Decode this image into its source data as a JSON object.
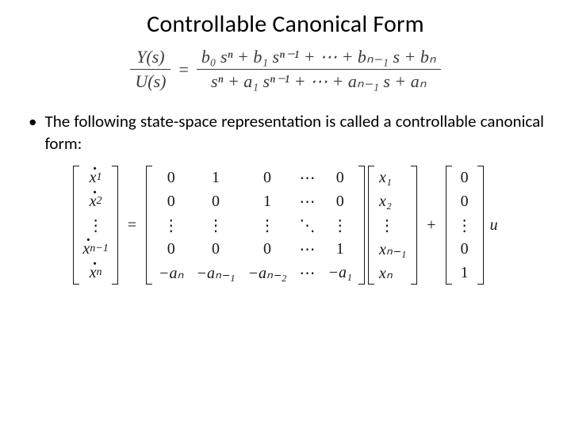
{
  "title": "Controllable Canonical Form",
  "transfer_function": {
    "left_num": "Y(s)",
    "left_den": "U(s)",
    "eq": "=",
    "right_num": "b₀ sⁿ + b₁ sⁿ⁻¹ + ⋯ + bₙ₋₁ s + bₙ",
    "right_den": "sⁿ + a₁ sⁿ⁻¹ + ⋯ + aₙ₋₁ s + aₙ"
  },
  "bullet": {
    "marker": "•",
    "text": "The following state-space representation is called a controllable canonical form:"
  },
  "state_equation": {
    "xdot_vector": [
      "ẋ₁",
      "ẋ₂",
      "⋮",
      "ẋₙ₋₁",
      "ẋₙ"
    ],
    "eq": "=",
    "A_matrix": {
      "rows": [
        [
          "0",
          "1",
          "0",
          "⋯",
          "0"
        ],
        [
          "0",
          "0",
          "1",
          "⋯",
          "0"
        ],
        [
          "⋮",
          "⋮",
          "⋮",
          "⋱",
          "⋮"
        ],
        [
          "0",
          "0",
          "0",
          "⋯",
          "1"
        ],
        [
          "−aₙ",
          "−aₙ₋₁",
          "−aₙ₋₂",
          "⋯",
          "−a₁"
        ]
      ]
    },
    "x_vector": [
      "x₁",
      "x₂",
      "⋮",
      "xₙ₋₁",
      "xₙ"
    ],
    "plus": "+",
    "B_vector": [
      "0",
      "0",
      "⋮",
      "0",
      "1"
    ],
    "input": "u"
  }
}
